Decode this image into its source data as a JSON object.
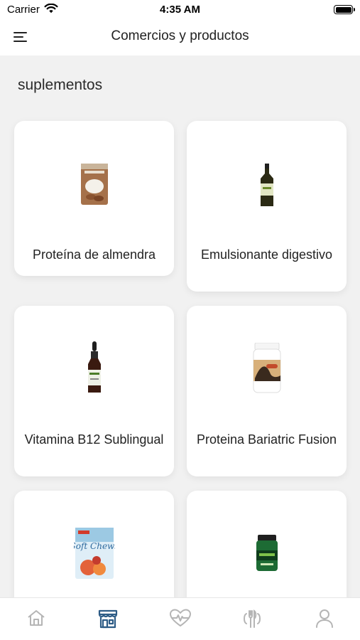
{
  "status_bar": {
    "carrier": "Carrier",
    "time": "4:35 AM"
  },
  "nav": {
    "title": "Comercios y productos"
  },
  "section": {
    "title": "suplementos"
  },
  "products": [
    {
      "name": "Proteína de almendra",
      "icon": "almond-protein-bag"
    },
    {
      "name": "Emulsionante digestivo",
      "icon": "dark-bottle"
    },
    {
      "name": "Vitamina B12 Sublingual",
      "icon": "dropper-bottle"
    },
    {
      "name": "Proteina Bariatric Fusion",
      "icon": "protein-tub"
    },
    {
      "name": "",
      "icon": "soft-chews-bag"
    },
    {
      "name": "",
      "icon": "green-supplement-tub"
    }
  ],
  "tabs": [
    {
      "icon": "home-icon",
      "active": false
    },
    {
      "icon": "store-icon",
      "active": true
    },
    {
      "icon": "heart-pulse-icon",
      "active": false
    },
    {
      "icon": "utensils-icon",
      "active": false
    },
    {
      "icon": "user-icon",
      "active": false
    }
  ],
  "colors": {
    "active_tab": "#2d5c86",
    "inactive_tab": "#b5b5b5",
    "background": "#f1f1f1"
  }
}
